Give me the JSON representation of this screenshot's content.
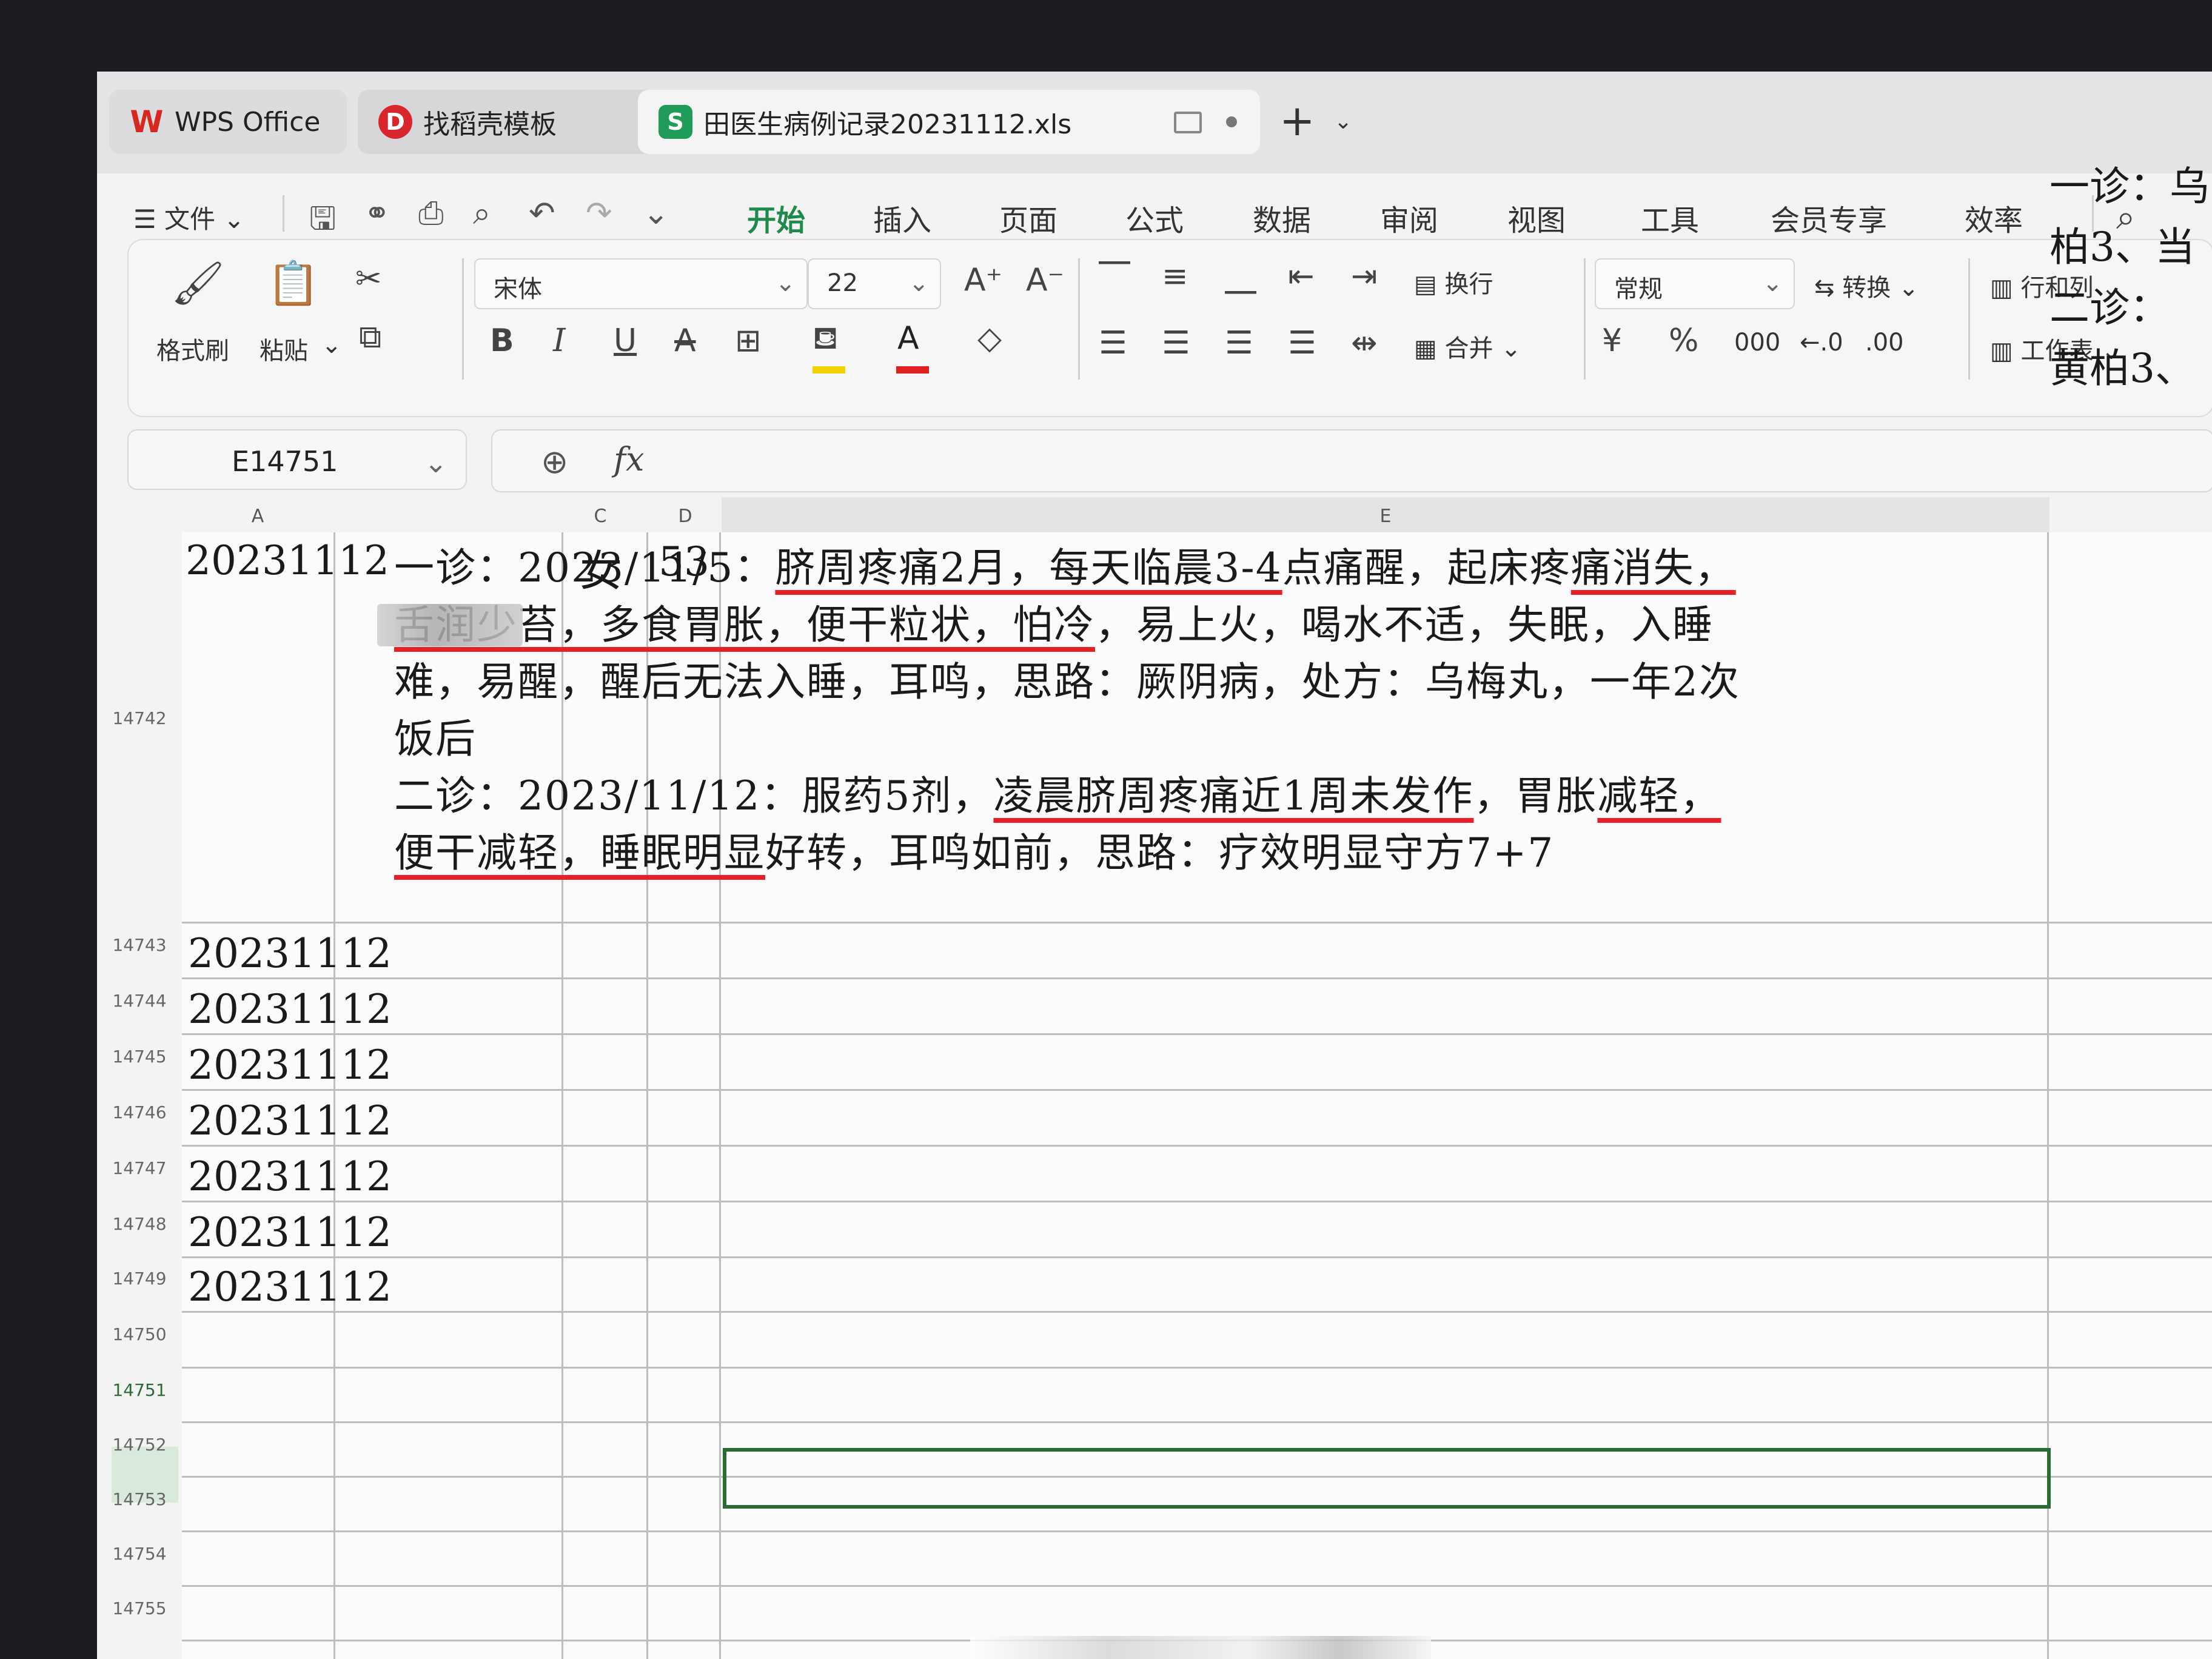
{
  "tabs": {
    "wps": "WPS Office",
    "template": "找稻壳模板",
    "file": "田医生病例记录20231112.xls",
    "new_tab": "+"
  },
  "menu": {
    "file_menu": "文件",
    "tabs": [
      "开始",
      "插入",
      "页面",
      "公式",
      "数据",
      "审阅",
      "视图",
      "工具",
      "会员专享",
      "效率"
    ],
    "active_tab": "开始"
  },
  "ribbon": {
    "format_painter": "格式刷",
    "paste": "粘贴",
    "font_name": "宋体",
    "font_size": "22",
    "wrap": "换行",
    "merge": "合并",
    "number_format": "常规",
    "convert": "转换",
    "row_col": "行和列",
    "worksheet": "工作表",
    "bold": "B",
    "italic": "I",
    "underline": "U",
    "percent": "%",
    "currency": "¥",
    "fill_color": "#f2d200",
    "font_color": "#e0201f"
  },
  "formula_bar": {
    "cell_ref": "E14751",
    "fx": "fx",
    "content": ""
  },
  "columns": [
    "A",
    "C",
    "D",
    "E"
  ],
  "rows": [
    {
      "num": "14742",
      "date": "20231112",
      "sex": "女",
      "age": "53"
    },
    {
      "num": "14743",
      "date": "20231112"
    },
    {
      "num": "14744",
      "date": "20231112"
    },
    {
      "num": "14745",
      "date": "20231112"
    },
    {
      "num": "14746",
      "date": "20231112"
    },
    {
      "num": "14747",
      "date": "20231112"
    },
    {
      "num": "14748",
      "date": "20231112"
    },
    {
      "num": "14749",
      "date": "20231112"
    },
    {
      "num": "14750"
    },
    {
      "num": "14751"
    },
    {
      "num": "14752"
    },
    {
      "num": "14753"
    },
    {
      "num": "14754"
    },
    {
      "num": "14755"
    }
  ],
  "record": {
    "v1_a": "一诊：2023/11/5：",
    "v1_b": "脐周疼痛2月，每天临晨3-4",
    "v1_c": "点痛醒，起床疼",
    "v1_d": "痛消失，舌润少苔，",
    "v1_e": "多食胃胀，便干粒状，怕冷",
    "v1_f": "，易上火，喝水不适，失眠，入睡难，易醒，醒后无法入睡，耳鸣，思路：厥阴病，处方：乌梅丸，一年2次饭后",
    "v2_a": "二诊：2023/11/12：服药5剂，",
    "v2_b": "凌晨脐周疼痛近1周未发作",
    "v2_c": "，胃胀",
    "v2_d": "减轻，便干减轻，睡眠明显",
    "v2_e": "好转，耳鸣如前，思路：疗效明显守方7+7"
  },
  "overflow_next": [
    "一诊：乌",
    "柏3、当",
    "二诊：",
    "黄柏3、"
  ]
}
